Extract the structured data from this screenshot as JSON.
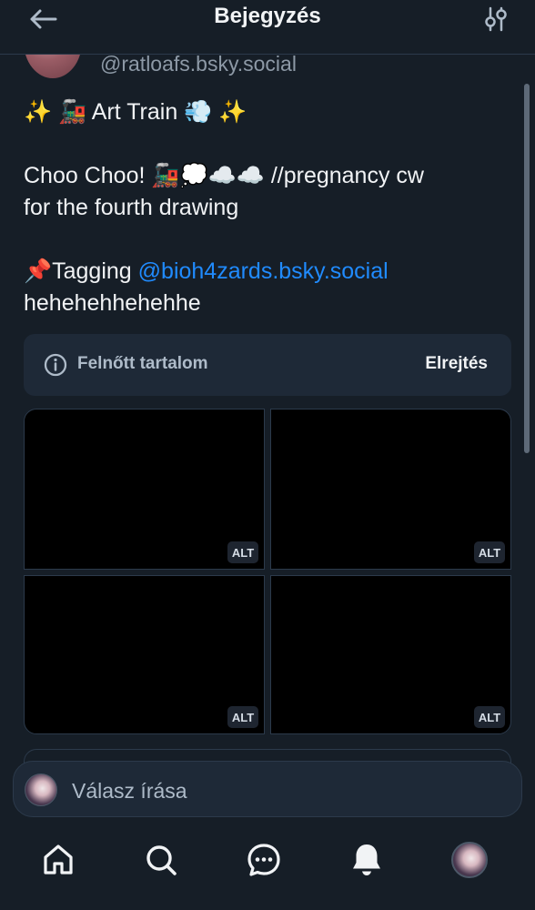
{
  "header": {
    "title": "Bejegyzés",
    "back_icon": "arrow-left-icon",
    "filter_icon": "sliders-icon"
  },
  "post": {
    "author_handle": "@ratloafs.bsky.social",
    "lines": {
      "title": "✨ 🚂 Art Train 💨 ✨",
      "line1": "Choo Choo! 🚂💭☁️☁️ //pregnancy cw",
      "line2": "for the fourth drawing",
      "tagging_prefix": "📌Tagging ",
      "mention": "@bioh4zards.bsky.social",
      "line4": "hehehehhehehhe"
    },
    "content_warning": {
      "label": "Felnőtt tartalom",
      "hide_label": "Elrejtés",
      "icon": "info-circle-icon"
    },
    "images": {
      "alt1": "ALT",
      "alt2": "ALT",
      "alt3": "ALT",
      "alt4": "ALT"
    }
  },
  "reply": {
    "placeholder": "Válasz írása"
  },
  "nav": {
    "items": [
      "home-icon",
      "search-icon",
      "chat-icon",
      "notifications-icon",
      "profile-avatar"
    ]
  },
  "colors": {
    "background": "#161e27",
    "surface": "#1e2937",
    "accent": "#208bfe",
    "border": "#2c3a4b",
    "muted": "#8d99a6"
  }
}
